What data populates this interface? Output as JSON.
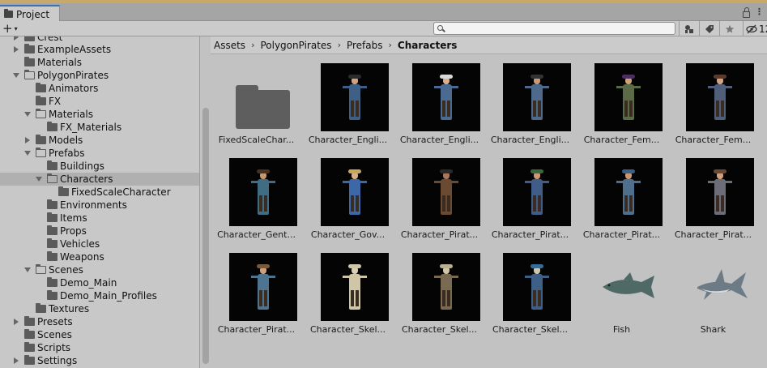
{
  "window": {
    "tab_label": "Project",
    "hidden_count": "12"
  },
  "toolbar": {
    "create_label": "+",
    "create_arrow": "▾",
    "search_placeholder": "",
    "icons": [
      "filter-by-type-icon",
      "filter-by-label-icon",
      "favorite-star-icon",
      "hidden-packages-icon"
    ]
  },
  "tree": {
    "items": [
      {
        "label": "Crest"
      },
      {
        "label": "ExampleAssets"
      },
      {
        "label": "Materials"
      },
      {
        "label": "PolygonPirates"
      },
      {
        "label": "Animators"
      },
      {
        "label": "FX"
      },
      {
        "label": "Materials"
      },
      {
        "label": "FX_Materials"
      },
      {
        "label": "Models"
      },
      {
        "label": "Prefabs"
      },
      {
        "label": "Buildings"
      },
      {
        "label": "Characters"
      },
      {
        "label": "FixedScaleCharacter"
      },
      {
        "label": "Environments"
      },
      {
        "label": "Items"
      },
      {
        "label": "Props"
      },
      {
        "label": "Vehicles"
      },
      {
        "label": "Weapons"
      },
      {
        "label": "Scenes"
      },
      {
        "label": "Demo_Main"
      },
      {
        "label": "Demo_Main_Profiles"
      },
      {
        "label": "Textures"
      },
      {
        "label": "Presets"
      },
      {
        "label": "Scenes"
      },
      {
        "label": "Scripts"
      },
      {
        "label": "Settings"
      }
    ]
  },
  "breadcrumb": {
    "items": [
      "Assets",
      "PolygonPirates",
      "Prefabs",
      "Characters"
    ],
    "separator": "›"
  },
  "assets": [
    {
      "label": "FixedScaleChar...",
      "kind": "folder"
    },
    {
      "label": "Character_Engli...",
      "kind": "character",
      "coat": "#3e5f86",
      "hat": "#2b2b2b",
      "skin": "#d3a27f"
    },
    {
      "label": "Character_Engli...",
      "kind": "character",
      "coat": "#4a6a92",
      "hat": "#d8d8d8",
      "skin": "#d9b08d"
    },
    {
      "label": "Character_Engli...",
      "kind": "character",
      "coat": "#4d6a8d",
      "hat": "#333333",
      "skin": "#c99a77"
    },
    {
      "label": "Character_Fem...",
      "kind": "character",
      "coat": "#5b6b47",
      "hat": "#4a2f5f",
      "skin": "#cfa07a"
    },
    {
      "label": "Character_Fem...",
      "kind": "character",
      "coat": "#4f5f7a",
      "hat": "#5a3a28",
      "skin": "#d4a482"
    },
    {
      "label": "Character_Gent...",
      "kind": "character",
      "coat": "#3f6d84",
      "hat": "#4a3020",
      "skin": "#c9976f"
    },
    {
      "label": "Character_Gov...",
      "kind": "character",
      "coat": "#3d68a8",
      "hat": "#c8a85a",
      "skin": "#d8b08a"
    },
    {
      "label": "Character_Pirat...",
      "kind": "character",
      "coat": "#6a4a30",
      "hat": "#2a2a2a",
      "skin": "#a87858"
    },
    {
      "label": "Character_Pirat...",
      "kind": "character",
      "coat": "#3f5d88",
      "hat": "#3a6a3a",
      "skin": "#c99a77"
    },
    {
      "label": "Character_Pirat...",
      "kind": "character",
      "coat": "#4f6f8f",
      "hat": "#3a5f88",
      "skin": "#c89874"
    },
    {
      "label": "Character_Pirat...",
      "kind": "character",
      "coat": "#6d6d7a",
      "hat": "#6a4a34",
      "skin": "#d2a07c"
    },
    {
      "label": "Character_Pirat...",
      "kind": "character",
      "coat": "#4f7490",
      "hat": "#7a5a3a",
      "skin": "#d0a07a"
    },
    {
      "label": "Character_Skel...",
      "kind": "character",
      "coat": "#cfc6a8",
      "hat": "#cfc6a8",
      "skin": "#d8d0b2"
    },
    {
      "label": "Character_Skel...",
      "kind": "character",
      "coat": "#7a6a52",
      "hat": "#b8ae92",
      "skin": "#cfc6a8"
    },
    {
      "label": "Character_Skel...",
      "kind": "character",
      "coat": "#3e5f86",
      "hat": "#3a6a96",
      "skin": "#cfc6a8"
    },
    {
      "label": "Fish",
      "kind": "fish",
      "color": "#4f6a66"
    },
    {
      "label": "Shark",
      "kind": "shark",
      "color": "#6d7b86"
    }
  ]
}
